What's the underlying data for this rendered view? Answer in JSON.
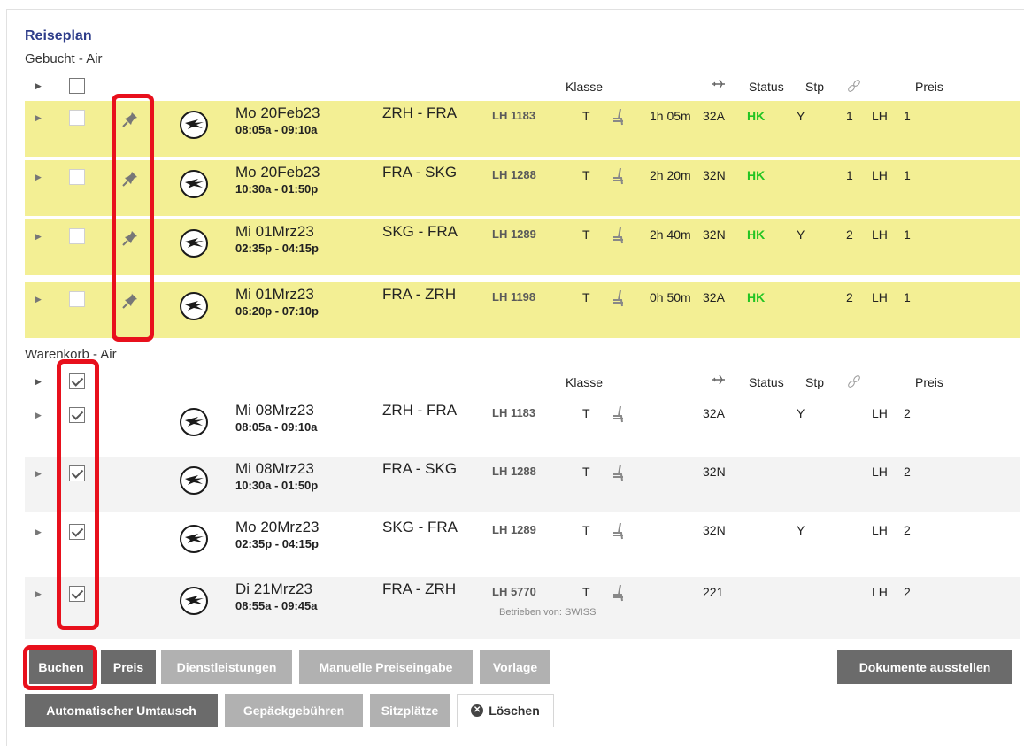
{
  "itinerary": {
    "title": "Reiseplan",
    "booked_section": "Gebucht - Air",
    "cart_section": "Warenkorb - Air"
  },
  "headers": {
    "klasse": "Klasse",
    "status": "Status",
    "stp": "Stp",
    "preis": "Preis"
  },
  "booked": [
    {
      "date": "Mo 20Feb23",
      "time": "08:05a - 09:10a",
      "route": "ZRH - FRA",
      "flight": "LH 1183",
      "klasse": "T",
      "duration": "1h 05m",
      "equipment": "32A",
      "status": "HK",
      "stp": "Y",
      "segment": "1",
      "carrier": "LH",
      "preis": "1"
    },
    {
      "date": "Mo 20Feb23",
      "time": "10:30a - 01:50p",
      "route": "FRA - SKG",
      "flight": "LH 1288",
      "klasse": "T",
      "duration": "2h 20m",
      "equipment": "32N",
      "status": "HK",
      "stp": "",
      "segment": "1",
      "carrier": "LH",
      "preis": "1"
    },
    {
      "date": "Mi 01Mrz23",
      "time": "02:35p - 04:15p",
      "route": "SKG - FRA",
      "flight": "LH 1289",
      "klasse": "T",
      "duration": "2h 40m",
      "equipment": "32N",
      "status": "HK",
      "stp": "Y",
      "segment": "2",
      "carrier": "LH",
      "preis": "1"
    },
    {
      "date": "Mi 01Mrz23",
      "time": "06:20p - 07:10p",
      "route": "FRA - ZRH",
      "flight": "LH 1198",
      "klasse": "T",
      "duration": "0h 50m",
      "equipment": "32A",
      "status": "HK",
      "stp": "",
      "segment": "2",
      "carrier": "LH",
      "preis": "1"
    }
  ],
  "cart": [
    {
      "date": "Mi 08Mrz23",
      "time": "08:05a - 09:10a",
      "route": "ZRH - FRA",
      "flight": "LH 1183",
      "klasse": "T",
      "equipment": "32A",
      "stp": "Y",
      "carrier": "LH",
      "preis": "2",
      "operated_by": ""
    },
    {
      "date": "Mi 08Mrz23",
      "time": "10:30a - 01:50p",
      "route": "FRA - SKG",
      "flight": "LH 1288",
      "klasse": "T",
      "equipment": "32N",
      "stp": "",
      "carrier": "LH",
      "preis": "2",
      "operated_by": ""
    },
    {
      "date": "Mo 20Mrz23",
      "time": "02:35p - 04:15p",
      "route": "SKG - FRA",
      "flight": "LH 1289",
      "klasse": "T",
      "equipment": "32N",
      "stp": "Y",
      "carrier": "LH",
      "preis": "2",
      "operated_by": ""
    },
    {
      "date": "Di 21Mrz23",
      "time": "08:55a - 09:45a",
      "route": "FRA - ZRH",
      "flight": "LH 5770",
      "klasse": "T",
      "equipment": "221",
      "stp": "",
      "carrier": "LH",
      "preis": "2",
      "operated_by": "Betrieben von: SWISS"
    }
  ],
  "buttons": {
    "buchen": "Buchen",
    "preis": "Preis",
    "dienstleistungen": "Dienstleistungen",
    "manuelle_preiseingabe": "Manuelle Preiseingabe",
    "vorlage": "Vorlage",
    "dokumente_ausstellen": "Dokumente ausstellen",
    "automatischer_umtausch": "Automatischer Umtausch",
    "gepaeckgebuehren": "Gepäckgebühren",
    "sitzplaetze": "Sitzplätze",
    "loeschen": "Löschen"
  },
  "colors": {
    "booked_row": "#f3ef94",
    "cart_row_alt": "#f3f3f3",
    "status_ok": "#22c422",
    "title": "#2e3d8a",
    "highlight": "#e8101c",
    "button_dark": "#6b6b6b",
    "button_light": "#b1b1b1"
  },
  "icons": {
    "airline_logo": "lufthansa-crane-icon",
    "pin": "pin-icon",
    "seat": "seat-icon",
    "plane": "plane-icon",
    "link": "link-icon",
    "expand": "expand-arrow-icon"
  }
}
